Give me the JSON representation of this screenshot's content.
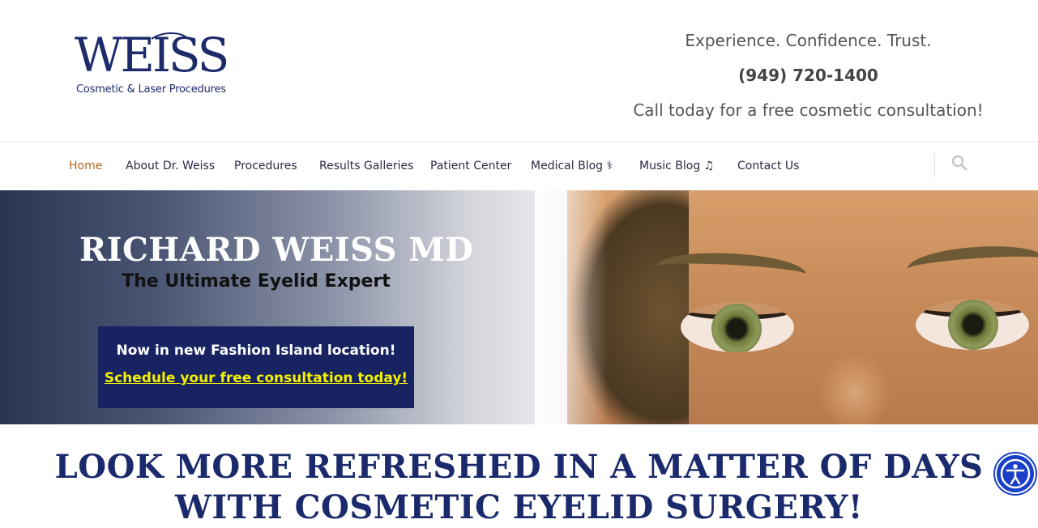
{
  "brand": {
    "logo_text": "WEISS",
    "logo_subtitle": "Cosmetic & Laser Procedures",
    "primary_color": "#1e2b6b"
  },
  "header": {
    "tagline": "Experience. Confidence. Trust.",
    "phone": "(949) 720-1400",
    "cta": "Call today for a free cosmetic consultation!"
  },
  "nav": {
    "items": [
      {
        "label": "Home",
        "active": true
      },
      {
        "label": "About Dr. Weiss"
      },
      {
        "label": "Procedures"
      },
      {
        "label": "Results Galleries"
      },
      {
        "label": "Patient Center"
      },
      {
        "label": "Medical Blog ⚕"
      },
      {
        "label": "Music Blog ♫"
      },
      {
        "label": "Contact Us"
      }
    ],
    "active_color": "#b8651b",
    "search_icon": "search-icon"
  },
  "hero": {
    "title": "RICHARD WEISS MD",
    "subtitle": "The Ultimate Eyelid Expert",
    "box_line": "Now in new Fashion Island location!",
    "box_link": "Schedule your free consultation today!",
    "box_color": "#172461",
    "link_color": "#f4f000"
  },
  "main": {
    "headline": "LOOK MORE REFRESHED IN A MATTER OF DAYS WITH COSMETIC EYELID SURGERY!"
  },
  "accessibility": {
    "icon": "accessibility-icon"
  }
}
